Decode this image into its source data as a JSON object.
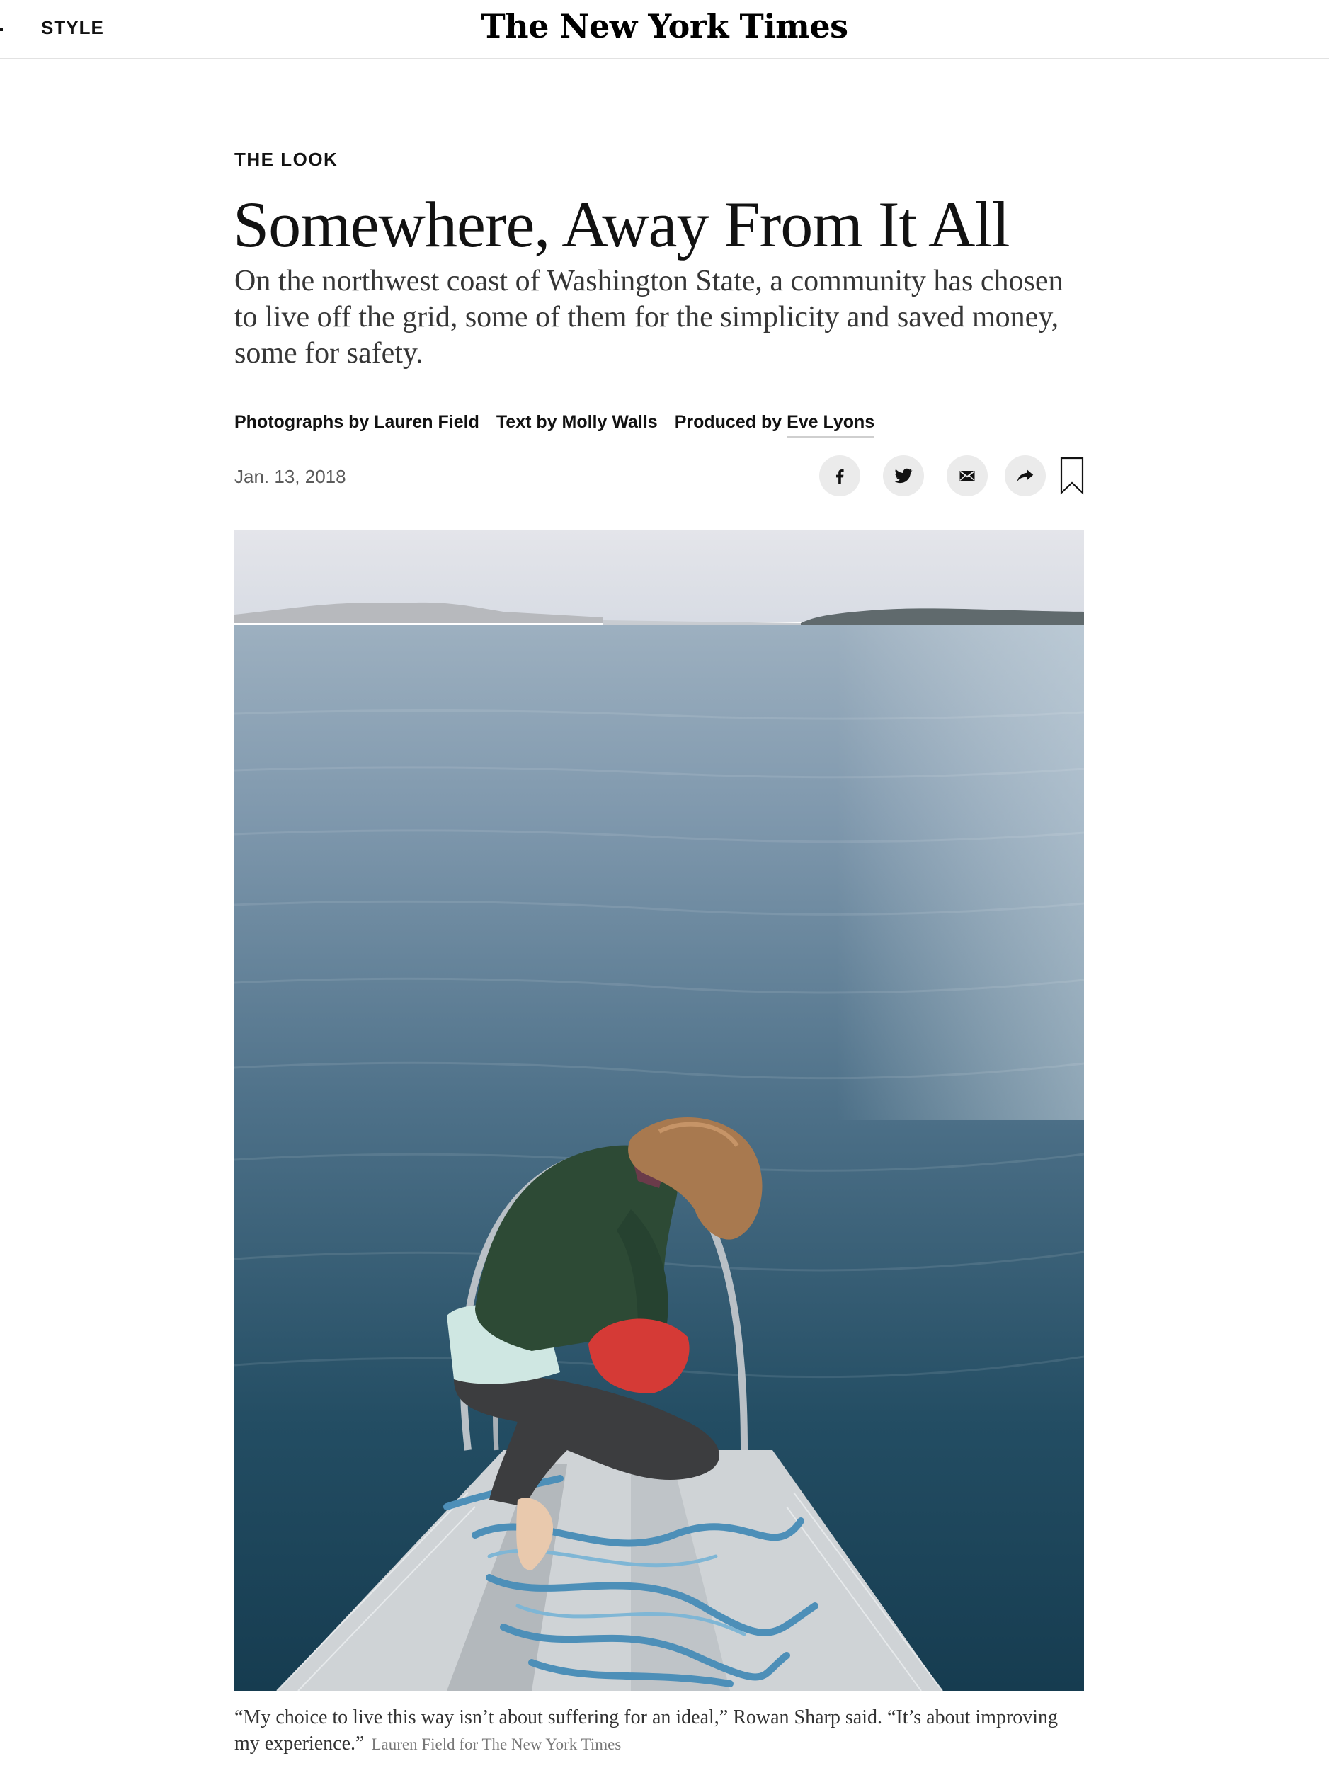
{
  "masthead": {
    "section_label": "STYLE",
    "logo_text": "The New York Times"
  },
  "article": {
    "kicker": "THE LOOK",
    "headline": "Somewhere, Away From It All",
    "summary": "On the northwest coast of Washington State, a community has chosen to live off the grid, some of them for the simplicity and saved money, some for safety.",
    "byline": {
      "photographs": "Photographs by Lauren Field",
      "text": "Text by Molly Walls",
      "produced_prefix": "Produced by",
      "producer_name": "Eve Lyons"
    },
    "date": "Jan. 13, 2018"
  },
  "share": {
    "icons": [
      "facebook-icon",
      "twitter-icon",
      "email-icon",
      "share-arrow-icon",
      "bookmark-icon"
    ]
  },
  "photo": {
    "caption": "“My choice to live this way isn’t about suffering for an ideal,” Rowan Sharp said. “It’s about improving my experience.”",
    "credit": "Lauren Field for The New York Times"
  },
  "colors": {
    "text": "#121212",
    "summary": "#363636",
    "meta": "#5a5a5a",
    "share_bg": "#ebebeb",
    "rule": "#e2e2e2"
  }
}
